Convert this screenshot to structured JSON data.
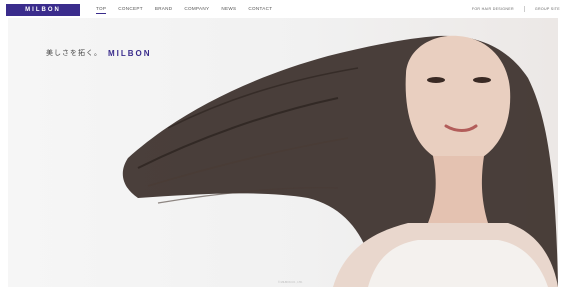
{
  "header": {
    "logo": "MILBON",
    "nav": [
      "TOP",
      "CONCEPT",
      "BRAND",
      "COMPANY",
      "NEWS",
      "CONTACT"
    ],
    "right_links": [
      "FOR HAIR DESIGNER",
      "GROUP SITE"
    ]
  },
  "hero": {
    "tagline_jp": "美しさを拓く。",
    "tagline_brand": "MILBON",
    "copyright": "© MILBON CO., LTD."
  },
  "colors": {
    "brand": "#3a2c8c",
    "hair": "#3b2f2a",
    "skin": "#e9cfc0",
    "top": "#f4f1ee"
  }
}
